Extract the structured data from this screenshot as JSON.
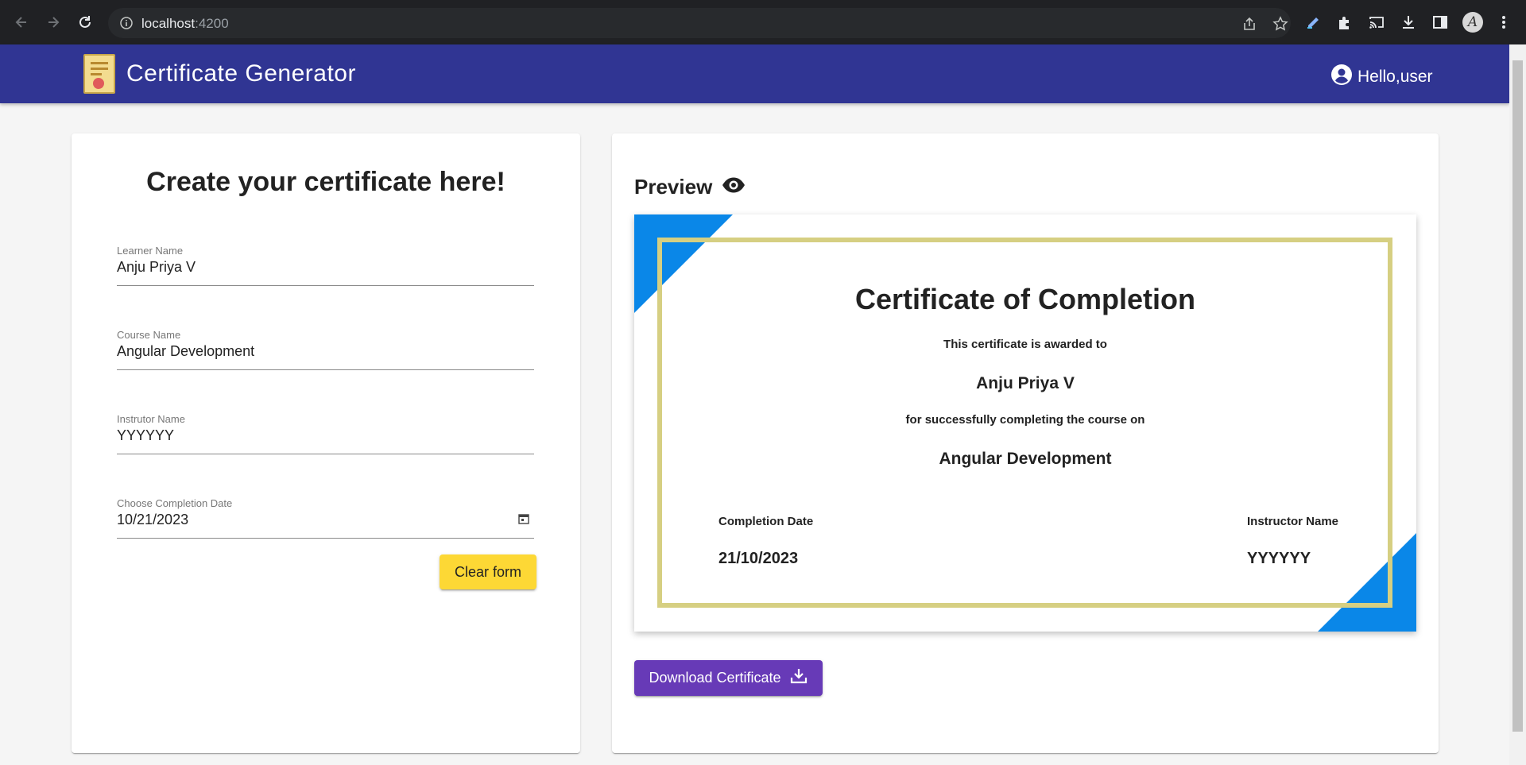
{
  "browser": {
    "url_host": "localhost",
    "url_port": ":4200",
    "profile_initial": "A"
  },
  "app": {
    "title": "Certificate Generator",
    "greeting": "Hello,user"
  },
  "form": {
    "title": "Create your certificate here!",
    "fields": [
      {
        "label": "Learner Name",
        "value": "Anju Priya V"
      },
      {
        "label": "Course Name",
        "value": "Angular Development"
      },
      {
        "label": "Instrutor Name",
        "value": "YYYYYY"
      },
      {
        "label": "Choose Completion Date",
        "value": "10/21/2023"
      }
    ],
    "clear_label": "Clear form"
  },
  "preview": {
    "title": "Preview",
    "certificate": {
      "heading": "Certificate of Completion",
      "awarded_text": "This certificate is awarded to",
      "learner_name": "Anju Priya V",
      "completion_text": "for successfully completing the course on",
      "course_name": "Angular Development",
      "date_label": "Completion Date",
      "date_value": "21/10/2023",
      "instructor_label": "Instructor Name",
      "instructor_value": "YYYYYY"
    },
    "download_label": "Download Certificate"
  },
  "colors": {
    "toolbar": "#303593",
    "clear_button": "#fdd835",
    "download_button": "#673ab7",
    "certificate_accent": "#0a87e8",
    "certificate_frame": "#d6cf82"
  }
}
